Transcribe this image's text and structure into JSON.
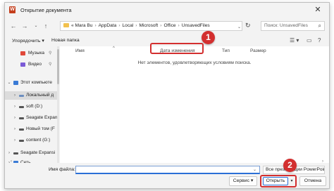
{
  "window": {
    "title": "Открытие документа",
    "app_icon": "word-icon",
    "close": "✕"
  },
  "nav": {
    "address": {
      "prefix": "«",
      "segments": [
        "Mara Bu",
        "AppData",
        "Local",
        "Microsoft",
        "Office",
        "UnsavedFiles"
      ],
      "separator": "›"
    },
    "search_placeholder": "Поиск: UnsavedFiles"
  },
  "toolbar": {
    "organize": "Упорядочить ▾",
    "new_folder": "Новая папка"
  },
  "sidebar": {
    "items": [
      {
        "label": "Музыка",
        "icon": "music-icon",
        "color": "#e0483a",
        "pinned": true
      },
      {
        "label": "Видео",
        "icon": "video-icon",
        "color": "#7b5bd6",
        "pinned": true
      },
      {
        "label": "Этот компьюте",
        "icon": "computer-icon",
        "color": "#3a7bd5",
        "chevron": "⌄"
      },
      {
        "label": "Локальный д",
        "icon": "drive-icon",
        "color": "#6c8ebf",
        "chevron": "›",
        "selected": true
      },
      {
        "label": "soft (D:)",
        "icon": "drive-icon",
        "color": "#555555",
        "chevron": "›"
      },
      {
        "label": "Seagate Expan",
        "icon": "drive-icon",
        "color": "#555555",
        "chevron": "›"
      },
      {
        "label": "Новый том (F",
        "icon": "drive-icon",
        "color": "#555555",
        "chevron": "›"
      },
      {
        "label": "content (G:)",
        "icon": "drive-icon",
        "color": "#555555",
        "chevron": "›"
      },
      {
        "label": "Seagate Expansi",
        "icon": "drive-icon",
        "color": "#555555",
        "chevron": "›"
      },
      {
        "label": "Сеть",
        "icon": "network-icon",
        "color": "#3a7bd5",
        "chevron": "›"
      }
    ]
  },
  "columns": [
    "Имя",
    "Дата изменения",
    "Тип",
    "Размер"
  ],
  "empty_message": "Нет элементов, удовлетворяющих условиям поиска.",
  "footer": {
    "filename_label": "Имя файла:",
    "filename_value": "",
    "filetype": "Все презентации PowerPoint",
    "service": "Сервис",
    "open": "Открыть",
    "cancel": "Отмена"
  },
  "annotations": [
    "1",
    "2"
  ],
  "colors": {
    "highlight": "#d32f2f",
    "accent": "#2a6fd6"
  }
}
